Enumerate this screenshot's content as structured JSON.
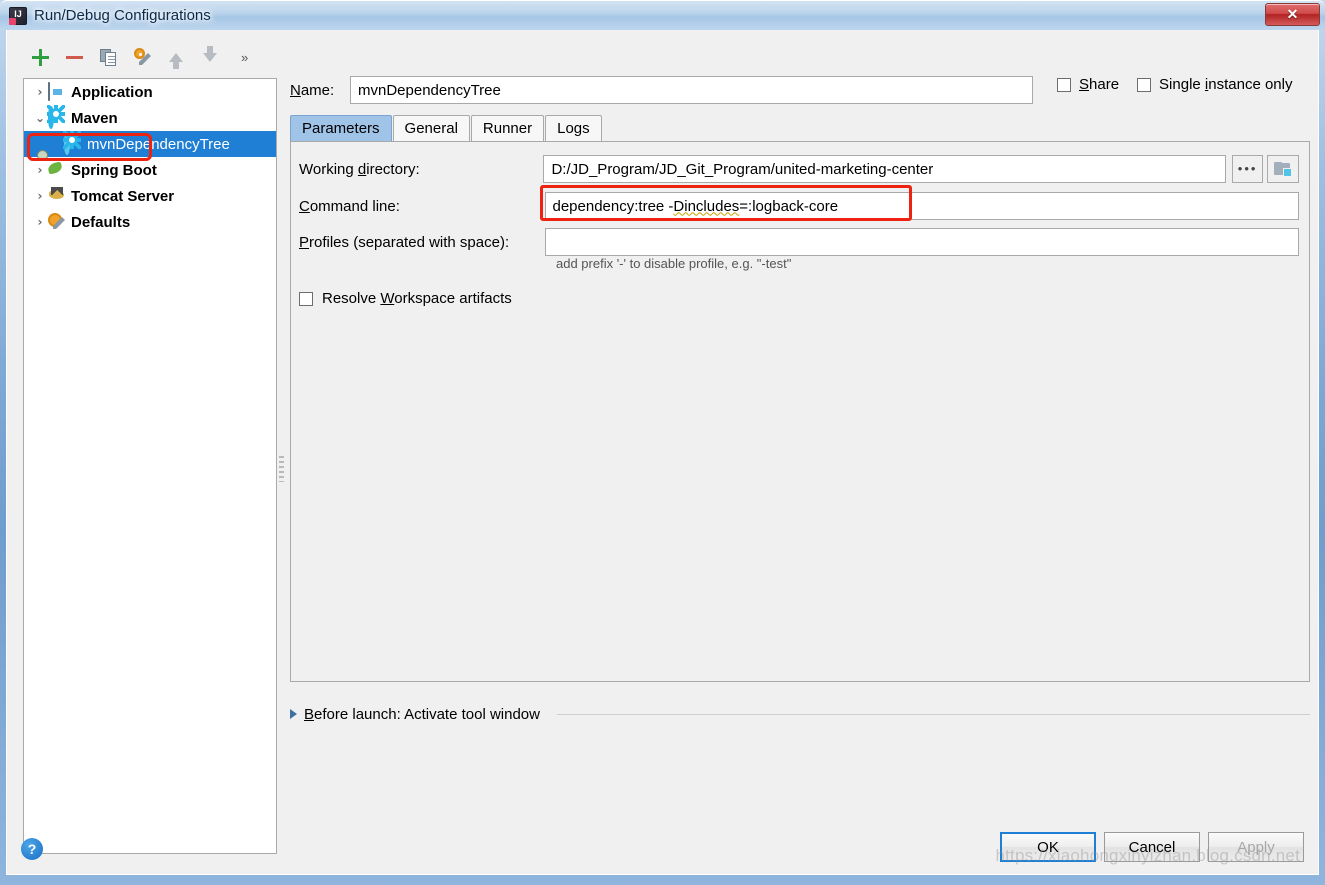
{
  "window": {
    "title": "Run/Debug Configurations",
    "app_icon": "intellij-idea-icon",
    "close_label": "✕"
  },
  "toolbar": {
    "items": [
      {
        "name": "add-button",
        "icon": "plus-icon",
        "label": "+"
      },
      {
        "name": "remove-button",
        "icon": "minus-icon",
        "label": "−"
      },
      {
        "name": "copy-button",
        "icon": "copy-icon",
        "label": "Copy Configuration"
      },
      {
        "name": "edit-templates-button",
        "icon": "wrench-icon",
        "label": "Edit Templates"
      },
      {
        "name": "move-up-button",
        "icon": "arrow-up-icon",
        "label": "Move Up"
      },
      {
        "name": "move-down-button",
        "icon": "arrow-down-icon",
        "label": "Move Down"
      }
    ],
    "overflow_label": "»"
  },
  "tree": {
    "items": [
      {
        "label": "Application",
        "icon": "application-icon",
        "twisty": "›",
        "expanded": false,
        "level": 0,
        "selected": false
      },
      {
        "label": "Maven",
        "icon": "maven-gear-icon",
        "twisty": "⌄",
        "expanded": true,
        "level": 0,
        "selected": false,
        "annotated": true
      },
      {
        "label": "mvnDependencyTree",
        "icon": "maven-gear-icon",
        "twisty": "",
        "expanded": false,
        "level": 1,
        "selected": true
      },
      {
        "label": "Spring Boot",
        "icon": "spring-boot-icon",
        "twisty": "›",
        "expanded": false,
        "level": 0,
        "selected": false
      },
      {
        "label": "Tomcat Server",
        "icon": "tomcat-icon",
        "twisty": "›",
        "expanded": false,
        "level": 0,
        "selected": false
      },
      {
        "label": "Defaults",
        "icon": "defaults-icon",
        "twisty": "›",
        "expanded": false,
        "level": 0,
        "selected": false
      }
    ]
  },
  "name_field": {
    "label_prefix": "N",
    "label_rest": "ame:",
    "value": "mvnDependencyTree",
    "placeholder": ""
  },
  "options": {
    "share": {
      "prefix": "S",
      "rest": "hare",
      "checked": false
    },
    "single_instance": {
      "pre": "Single ",
      "mnem": "i",
      "post": "nstance only",
      "checked": false
    }
  },
  "tabs": [
    {
      "label": "Parameters",
      "active": true
    },
    {
      "label": "General",
      "active": false
    },
    {
      "label": "Runner",
      "active": false
    },
    {
      "label": "Logs",
      "active": false
    }
  ],
  "parameters": {
    "working_directory": {
      "label_pre": "Working ",
      "label_mnem": "d",
      "label_post": "irectory:",
      "value": "D:/JD_Program/JD_Git_Program/united-marketing-center",
      "browse_label": "•••",
      "module_button": "module-icon"
    },
    "command_line": {
      "label_mnem": "C",
      "label_post": "ommand line:",
      "value_plain": "dependency:tree -",
      "value_squiggly": "Dincludes",
      "value_tail": "=:logback-core",
      "full_value": "dependency:tree -Dincludes=:logback-core",
      "annotated": true
    },
    "profiles": {
      "label_mnem": "P",
      "label_post": "rofiles (separated with space):",
      "value": "",
      "hint": "add prefix '-' to disable profile, e.g. \"-test\""
    },
    "resolve_workspace": {
      "pre": "Resolve ",
      "mnem": "W",
      "post": "orkspace artifacts",
      "checked": false
    }
  },
  "before_launch": {
    "mnem": "B",
    "label_post": "efore launch: Activate tool window",
    "expanded": false
  },
  "buttons": {
    "ok": "OK",
    "cancel": "Cancel",
    "apply": "Apply",
    "help": "?"
  },
  "watermark": "https://xiaohongxinyizhan.blog.csdn.net",
  "colors": {
    "selection": "#1f7fd4",
    "annotation": "#ee2211",
    "tab_active": "#a0c4e8",
    "accent": "#29b6e8"
  }
}
